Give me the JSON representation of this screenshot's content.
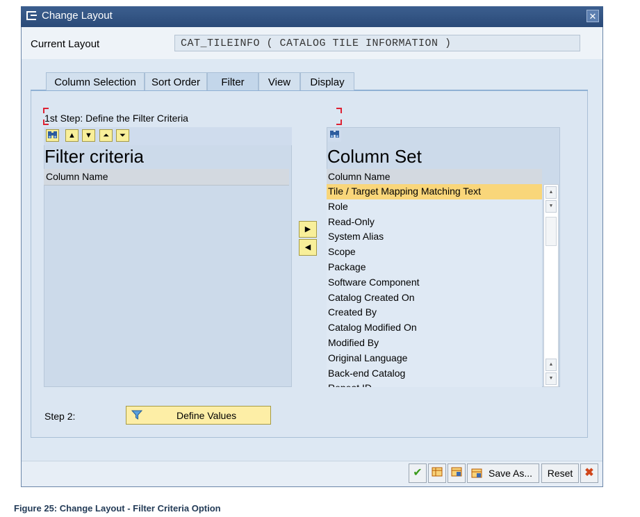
{
  "dialog": {
    "title": "Change Layout",
    "close_glyph": "✕"
  },
  "current_layout": {
    "label": "Current Layout",
    "value": "CAT_TILEINFO ( CATALOG TILE INFORMATION )"
  },
  "tabs": [
    {
      "label": "Column Selection",
      "active": false
    },
    {
      "label": "Sort Order",
      "active": false
    },
    {
      "label": "Filter",
      "active": true
    },
    {
      "label": "View",
      "active": false
    },
    {
      "label": "Display",
      "active": false
    }
  ],
  "step1": {
    "label": "1st Step: Define the Filter Criteria"
  },
  "filter_criteria": {
    "title": "Filter criteria",
    "column_header": "Column Name"
  },
  "column_set": {
    "title": "Column Set",
    "column_header": "Column Name",
    "selected_index": 0,
    "items": [
      "Tile / Target Mapping Matching Text",
      "Role",
      "Read-Only",
      "System Alias",
      "Scope",
      "Package",
      "Software Component",
      "Catalog Created On",
      "Created By",
      "Catalog Modified On",
      "Modified By",
      "Original Language",
      "Back-end Catalog",
      "Repeat ID"
    ]
  },
  "step2": {
    "label": "Step 2:",
    "button_label": "Define Values"
  },
  "footer": {
    "save_as_label": "Save As...",
    "reset_label": "Reset"
  },
  "caption": "Figure 25: Change Layout - Filter Criteria Option",
  "colors": {
    "title_bar": "#2f5283",
    "selected_row": "#f9d67a",
    "button_yellow": "#f8ef9a",
    "panel": "#dbe6f2"
  },
  "icons": [
    "binoculars-icon",
    "arrow-up-icon",
    "arrow-down-icon",
    "arrow-top-icon",
    "arrow-bottom-icon",
    "move-right-icon",
    "move-left-icon",
    "filter-icon",
    "checkmark-icon",
    "layout-icon",
    "save-layout-icon",
    "cancel-icon"
  ]
}
